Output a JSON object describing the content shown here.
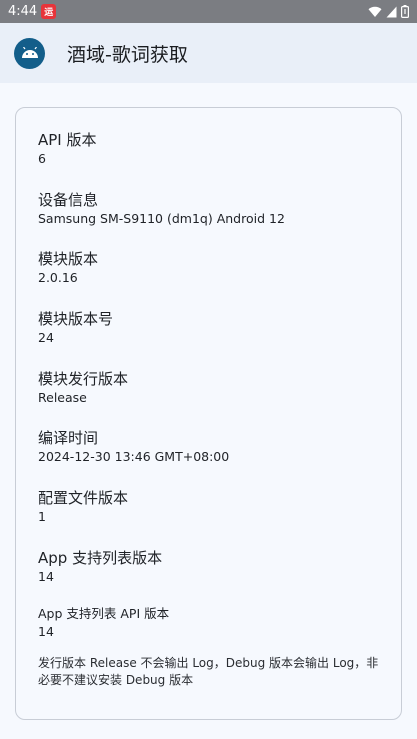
{
  "status_bar": {
    "time": "4:44",
    "notification_glyph": "运"
  },
  "app_bar": {
    "title": "酒域-歌词获取",
    "logo_icon": "android-icon"
  },
  "info": [
    {
      "label": "API 版本",
      "value": "6"
    },
    {
      "label": "设备信息",
      "value": "Samsung SM-S9110 (dm1q) Android 12"
    },
    {
      "label": "模块版本",
      "value": "2.0.16"
    },
    {
      "label": "模块版本号",
      "value": "24"
    },
    {
      "label": "模块发行版本",
      "value": "Release"
    },
    {
      "label": "编译时间",
      "value": "2024-12-30 13:46 GMT+08:00"
    },
    {
      "label": "配置文件版本",
      "value": "1"
    },
    {
      "label": "App 支持列表版本",
      "value": "14"
    },
    {
      "label": "App 支持列表 API 版本",
      "value": "14"
    }
  ],
  "note": "发行版本 Release 不会输出 Log，Debug 版本会输出 Log，非必要不建议安装 Debug 版本",
  "colors": {
    "status_bar": "#7b7d82",
    "app_bar": "#e9eff8",
    "background": "#f6f9fe",
    "logo": "#135e8a",
    "notif_badge": "#e7343a"
  }
}
